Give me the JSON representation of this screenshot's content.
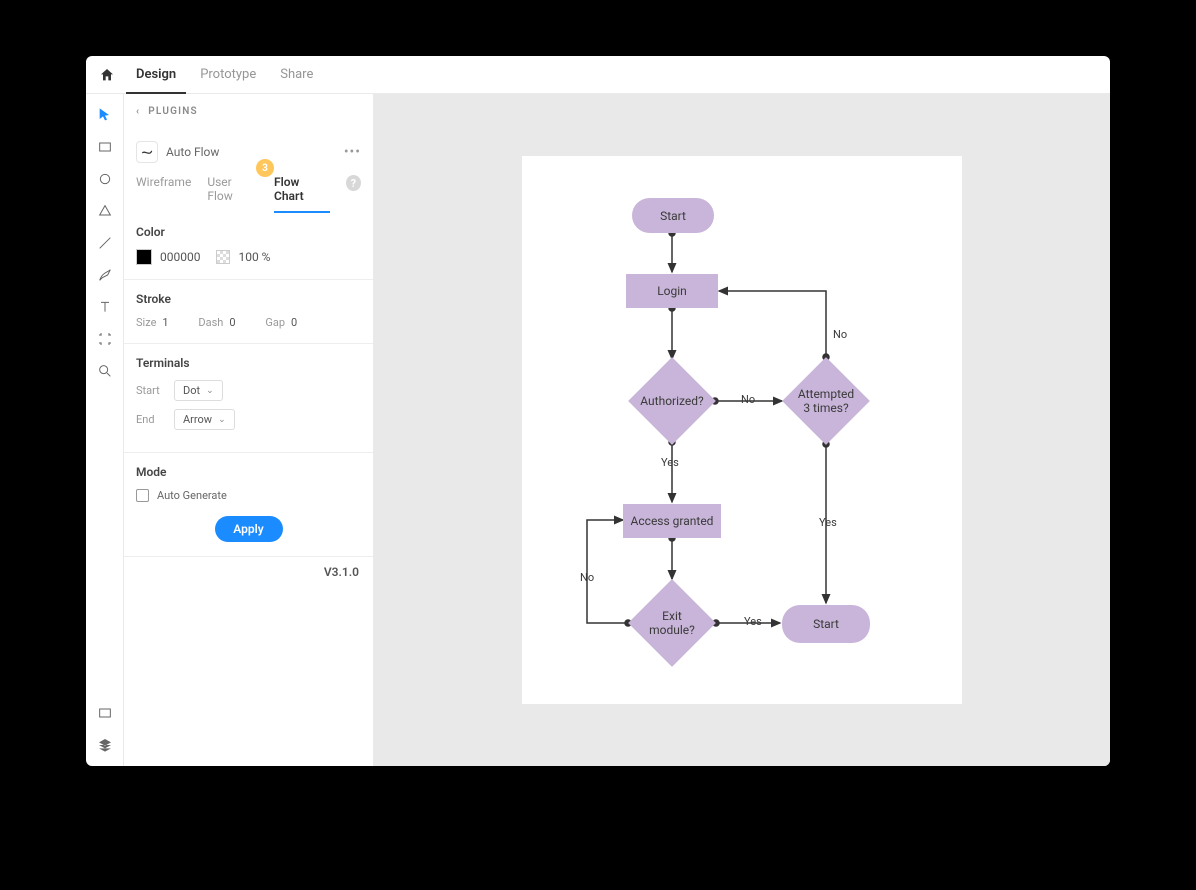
{
  "topbar": {
    "tabs": [
      "Design",
      "Prototype",
      "Share"
    ],
    "active": "Design"
  },
  "panel": {
    "back_label": "PLUGINS",
    "plugin_name": "Auto Flow",
    "subtabs": [
      "Wireframe",
      "User Flow",
      "Flow Chart"
    ],
    "active_subtab": "Flow Chart",
    "badge": "3",
    "color_label": "Color",
    "color_value": "000000",
    "opacity_value": "100 %",
    "stroke_label": "Stroke",
    "stroke_size_label": "Size",
    "stroke_size_value": "1",
    "stroke_dash_label": "Dash",
    "stroke_dash_value": "0",
    "stroke_gap_label": "Gap",
    "stroke_gap_value": "0",
    "terminals_label": "Terminals",
    "terminal_start_label": "Start",
    "terminal_start_value": "Dot",
    "terminal_end_label": "End",
    "terminal_end_value": "Arrow",
    "mode_label": "Mode",
    "auto_generate_label": "Auto Generate",
    "apply_label": "Apply",
    "version": "V3.1.0"
  },
  "flowchart": {
    "nodes": {
      "start": "Start",
      "login": "Login",
      "authorized": "Authorized?",
      "attempted": "Attempted\n3 times?",
      "access_granted": "Access granted",
      "exit_module": "Exit\nmodule?",
      "end": "Start"
    },
    "labels": {
      "yes1": "Yes",
      "yes2": "Yes",
      "yes3": "Yes",
      "no1": "No",
      "no2": "No",
      "no3": "No"
    }
  }
}
